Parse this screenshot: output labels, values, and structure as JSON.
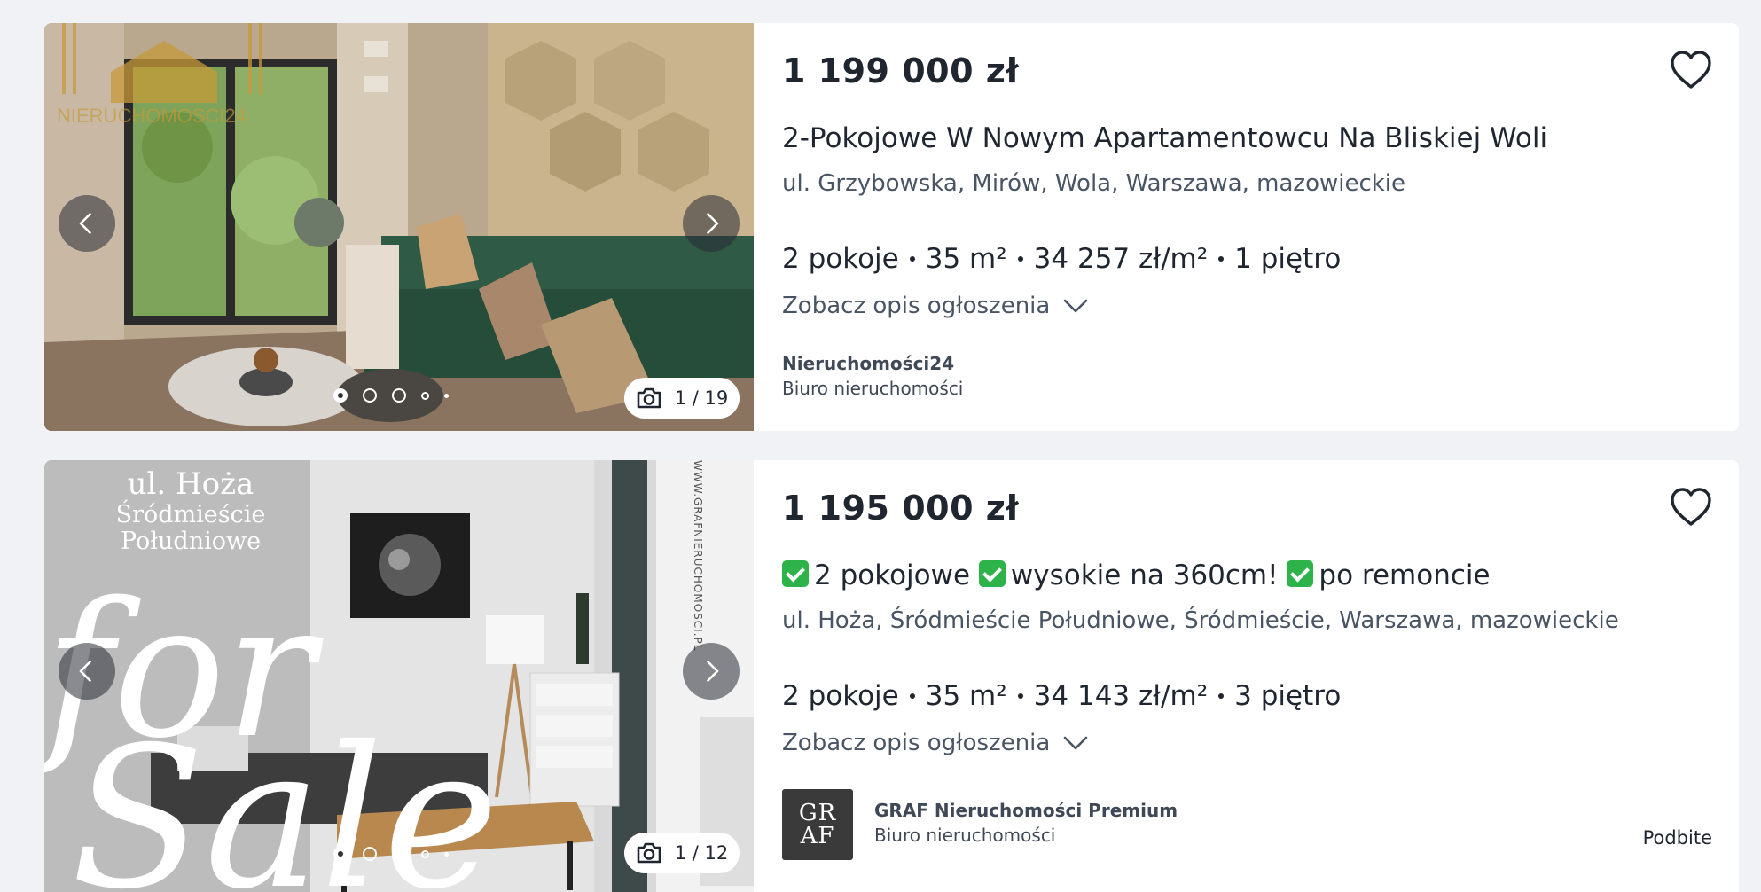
{
  "listings": [
    {
      "price": "1 199 000 zł",
      "title": "2-Pokojowe W Nowym Apartamentowcu Na Bliskiej Woli",
      "address": "ul. Grzybowska, Mirów, Wola, Warszawa, mazowieckie",
      "params": [
        "2 pokoje",
        "35 m²",
        "34 257 zł/m²",
        "1 piętro"
      ],
      "description_link": "Zobacz opis ogłoszenia",
      "agency_name": "Nieruchomości24",
      "agency_type": "Biuro nieruchomości",
      "photo_counter": "1 / 19",
      "watermark": "NIERUCHOMOSCI24"
    },
    {
      "price": "1 195 000 zł",
      "title_parts": [
        "2 pokojowe",
        "wysokie na 360cm!",
        "po remoncie"
      ],
      "address": "ul. Hoża, Śródmieście Południowe, Śródmieście, Warszawa, mazowieckie",
      "params": [
        "2 pokoje",
        "35 m²",
        "34 143 zł/m²",
        "3 piętro"
      ],
      "description_link": "Zobacz opis ogłoszenia",
      "agency_name": "GRAF Nieruchomości Premium",
      "agency_type": "Biuro nieruchomości",
      "agency_logo": [
        "GR",
        "AF"
      ],
      "photo_counter": "1 / 12",
      "bumped_label": "Podbite",
      "photo_overlay": [
        "ul. Hoża",
        "Śródmieście",
        "Południowe"
      ],
      "side_text": "WWW.GRAFNIERUCHOMOSCI.PL",
      "sale_text_1": "for",
      "sale_text_2": "Sale"
    }
  ],
  "icons": {
    "prev": "chevron-left-icon",
    "next": "chevron-right-icon",
    "camera": "camera-icon",
    "favorite": "heart-outline-icon",
    "expand": "chevron-down-icon",
    "check": "check-mark-icon"
  },
  "colors": {
    "background": "#f0f2f5",
    "card": "#ffffff",
    "text_primary": "#1f2630",
    "text_secondary": "#495564",
    "check_green": "#2db34a"
  }
}
